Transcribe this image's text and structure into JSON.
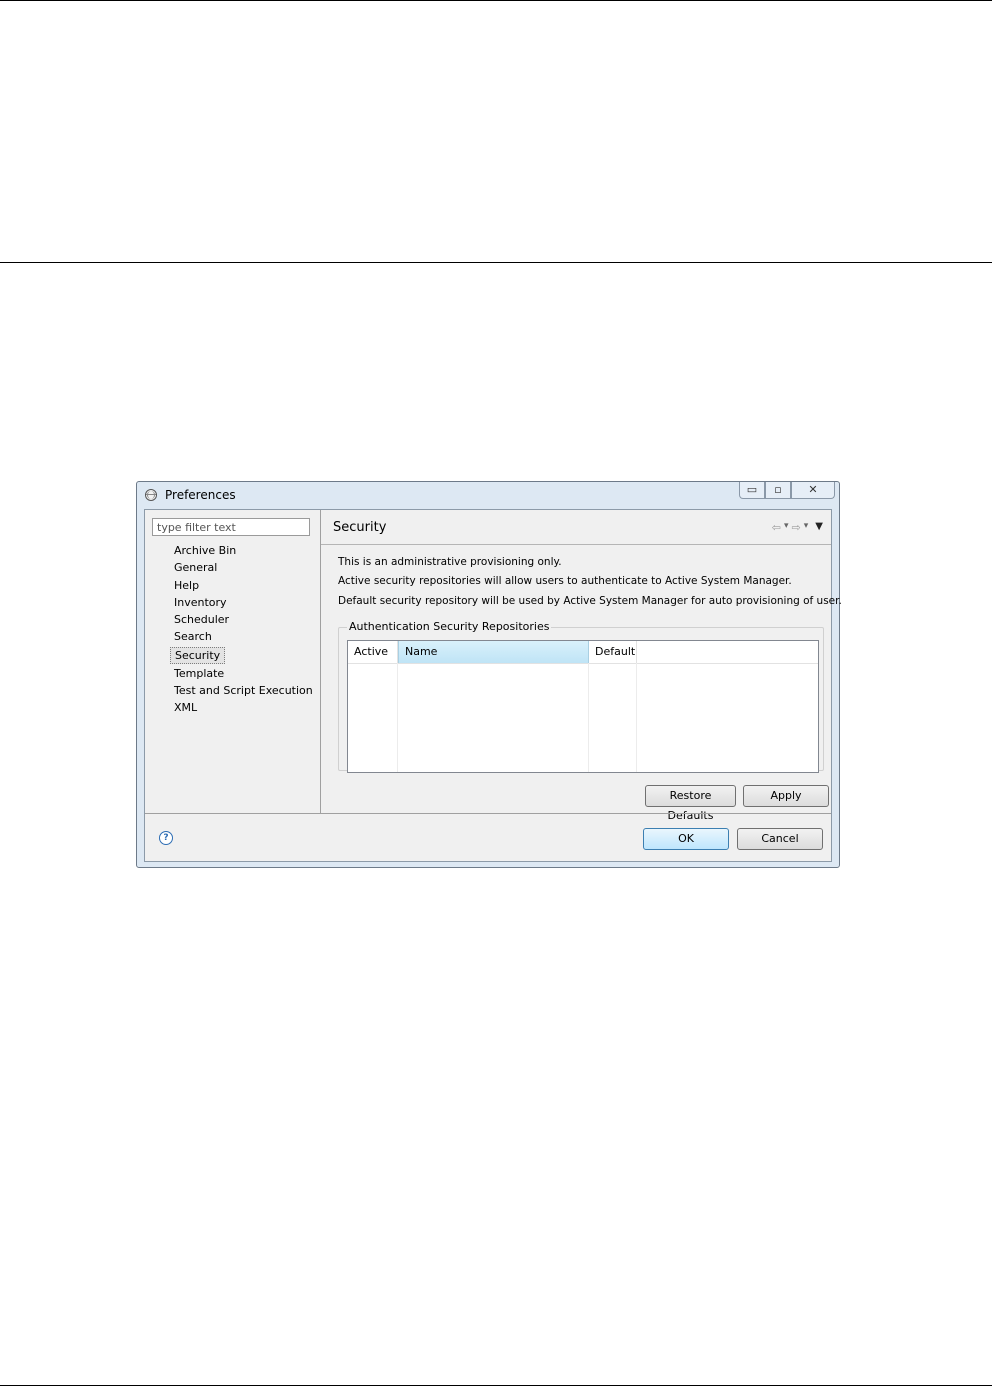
{
  "window": {
    "title": "Preferences"
  },
  "window_controls": {
    "minimize": "▭",
    "restore": "▫",
    "close": "✕"
  },
  "filter": {
    "placeholder": "type filter text"
  },
  "tree": {
    "items": [
      "Archive Bin",
      "General",
      "Help",
      "Inventory",
      "Scheduler",
      "Search",
      "Security",
      "Template",
      "Test and Script Execution",
      "XML"
    ],
    "selected": "Security"
  },
  "page": {
    "title": "Security",
    "nav": {
      "back": "⇦",
      "forward": "⇨",
      "dropdown": "▾",
      "menu": "▼"
    },
    "descriptions": [
      "This is an administrative provisioning only.",
      "Active security repositories will allow users to authenticate to Active System Manager.",
      "Default security repository will be used by Active System Manager for auto provisioning of user."
    ],
    "group_label": "Authentication Security Repositories",
    "table": {
      "columns": [
        "Active",
        "Name",
        "Default"
      ]
    }
  },
  "buttons": {
    "restore_defaults": "Restore Defaults",
    "apply": "Apply",
    "ok": "OK",
    "cancel": "Cancel"
  },
  "help": {
    "glyph": "?"
  }
}
